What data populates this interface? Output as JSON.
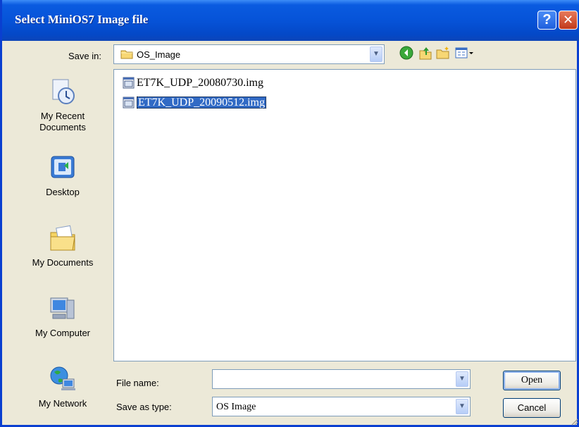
{
  "window": {
    "title": "Select MiniOS7 Image file",
    "help_label": "?",
    "close_label": "✕"
  },
  "save_in": {
    "label": "Save in:",
    "value": "OS_Image"
  },
  "places": [
    {
      "label": "My Recent Documents",
      "icon": "recent-documents-icon"
    },
    {
      "label": "Desktop",
      "icon": "desktop-icon"
    },
    {
      "label": "My Documents",
      "icon": "my-documents-icon"
    },
    {
      "label": "My Computer",
      "icon": "my-computer-icon"
    },
    {
      "label": "My Network",
      "icon": "my-network-icon"
    }
  ],
  "files": [
    {
      "name": "ET7K_UDP_20080730.img",
      "selected": false
    },
    {
      "name": "ET7K_UDP_20090512.img",
      "selected": true
    }
  ],
  "file_name": {
    "label": "File name:",
    "value": ""
  },
  "save_as_type": {
    "label": "Save as type:",
    "value": "OS Image"
  },
  "buttons": {
    "open": "Open",
    "cancel": "Cancel"
  },
  "colors": {
    "titlebar": "#0653d8",
    "selection": "#316ac5",
    "dialog_bg": "#ece9d8",
    "border": "#7f9db9"
  }
}
